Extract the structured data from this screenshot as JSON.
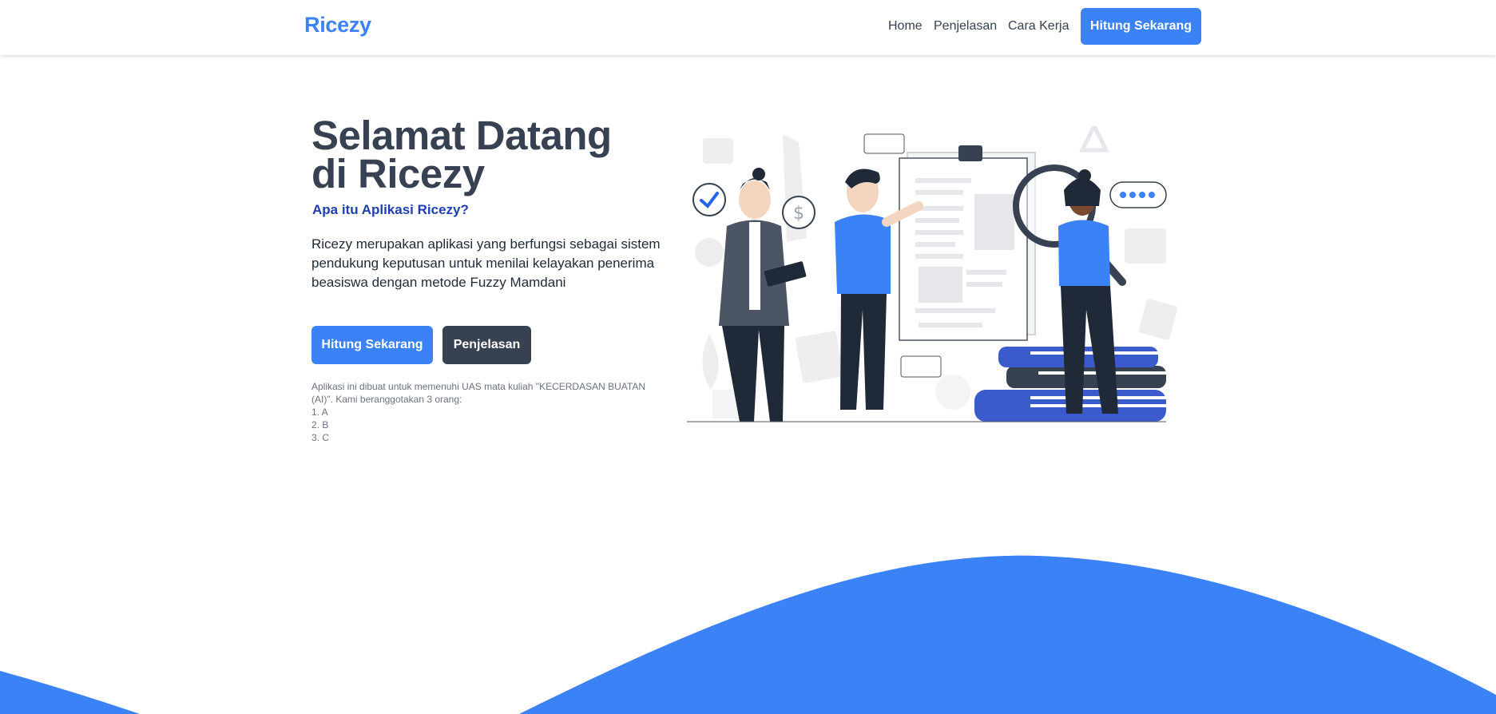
{
  "nav": {
    "brand": "Ricezy",
    "links": [
      "Home",
      "Penjelasan",
      "Cara Kerja"
    ],
    "cta": "Hitung Sekarang"
  },
  "hero": {
    "title_line1": "Selamat Datang",
    "title_line2": "di Ricezy",
    "subtitle": "Apa itu Aplikasi Ricezy?",
    "description": "Ricezy merupakan aplikasi yang berfungsi sebagai sistem pendukung keputusan untuk menilai kelayakan penerima beasiswa dengan metode Fuzzy Mamdani",
    "primary_button": "Hitung Sekarang",
    "secondary_button": "Penjelasan",
    "note_intro": "Aplikasi ini dibuat untuk memenuhi UAS mata kuliah \"KECERDASAN BUATAN (AI)\". Kami beranggotakan 3 orang:",
    "members": [
      "1. A",
      "2. B",
      "3. C"
    ]
  },
  "illustration": {
    "icon": "team-research-illustration",
    "dollar_symbol": "$"
  },
  "colors": {
    "primary": "#3b82f6",
    "dark": "#374151",
    "accent_text": "#1e40af"
  }
}
